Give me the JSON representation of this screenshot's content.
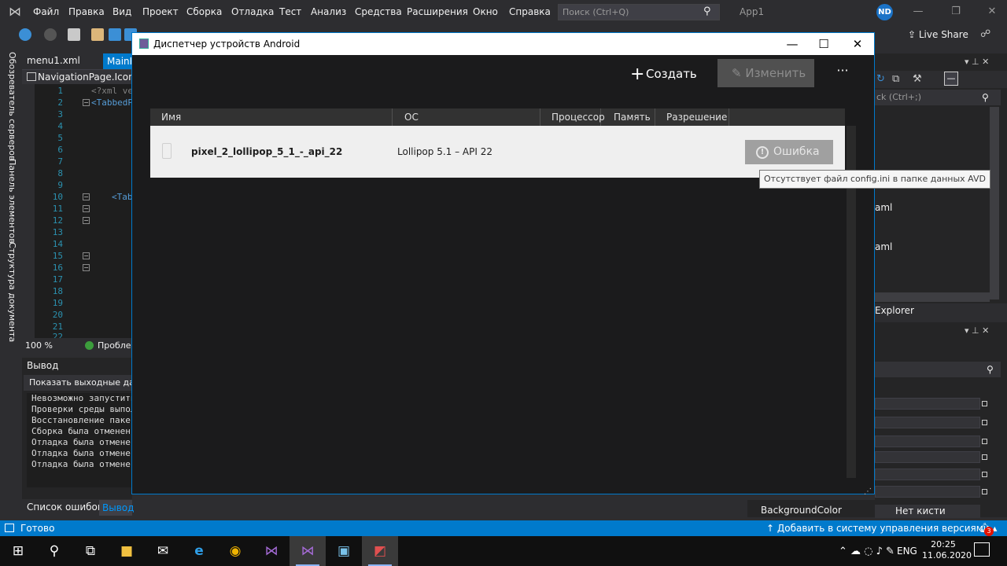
{
  "menubar": {
    "items": [
      "Файл",
      "Правка",
      "Вид",
      "Проект",
      "Сборка",
      "Отладка",
      "Тест",
      "Анализ",
      "Средства",
      "Расширения",
      "Окно",
      "Справка"
    ],
    "search_placeholder": "Поиск (Ctrl+Q)",
    "app_name": "App1",
    "user_initials": "ND"
  },
  "toolbar": {
    "live_share": "Live Share"
  },
  "side_tabs": [
    "Обозреватель серверов",
    "Панель элементов",
    "Структура документа"
  ],
  "editor": {
    "tabs": [
      "menu1.xml",
      "MainP"
    ],
    "nav_label": "NavigationPage.Icon",
    "line_numbers": [
      "1",
      "2",
      "3",
      "4",
      "5",
      "6",
      "7",
      "8",
      "9",
      "10",
      "11",
      "12",
      "13",
      "14",
      "15",
      "16",
      "17",
      "18",
      "19",
      "20",
      "21",
      "22"
    ],
    "code_lines": [
      "<?xml ve",
      "<TabbedP",
      "<Tab"
    ],
    "zoom": "100 %",
    "issues": "Проблем"
  },
  "output": {
    "title": "Вывод",
    "show_label": "Показать выходные данн",
    "lines": [
      "Невозможно запустить",
      "Проверки среды выпол",
      "Восстановление паке",
      "Сборка была отменен",
      "Отладка была отмене",
      "Отладка была отмене",
      "Отладка была отмене"
    ],
    "tabs": [
      "Список ошибок",
      "Вывод"
    ]
  },
  "right_panel": {
    "search_placeholder": "ck (Ctrl+;)",
    "item1": "aml",
    "item2": "aml",
    "explorer_tab": "Explorer",
    "prop_label": "BackgroundColor",
    "prop_value": "Нет кисти"
  },
  "statusbar": {
    "text": "Готово",
    "version_control": "Добавить в систему управления версиями",
    "notifications": "3"
  },
  "taskbar": {
    "lang": "ENG",
    "time": "20:25",
    "date": "11.06.2020"
  },
  "dialog": {
    "title": "Диспетчер устройств Android",
    "create": "Создать",
    "edit": "Изменить",
    "more": "···",
    "columns": [
      "Имя",
      "ОС",
      "Процессор",
      "Память",
      "Разрешение"
    ],
    "rows": [
      {
        "name": "pixel_2_lollipop_5_1_-_api_22",
        "os": "Lollipop 5.1 – API 22",
        "status": "Ошибка"
      }
    ],
    "tooltip": "Отсутствует файл config.ini в папке данных AVD"
  },
  "colors": {
    "accent": "#007acc",
    "chrome": "#2d2d30",
    "dialog_bg": "#1b1b1c",
    "row_bg": "#efefef"
  }
}
